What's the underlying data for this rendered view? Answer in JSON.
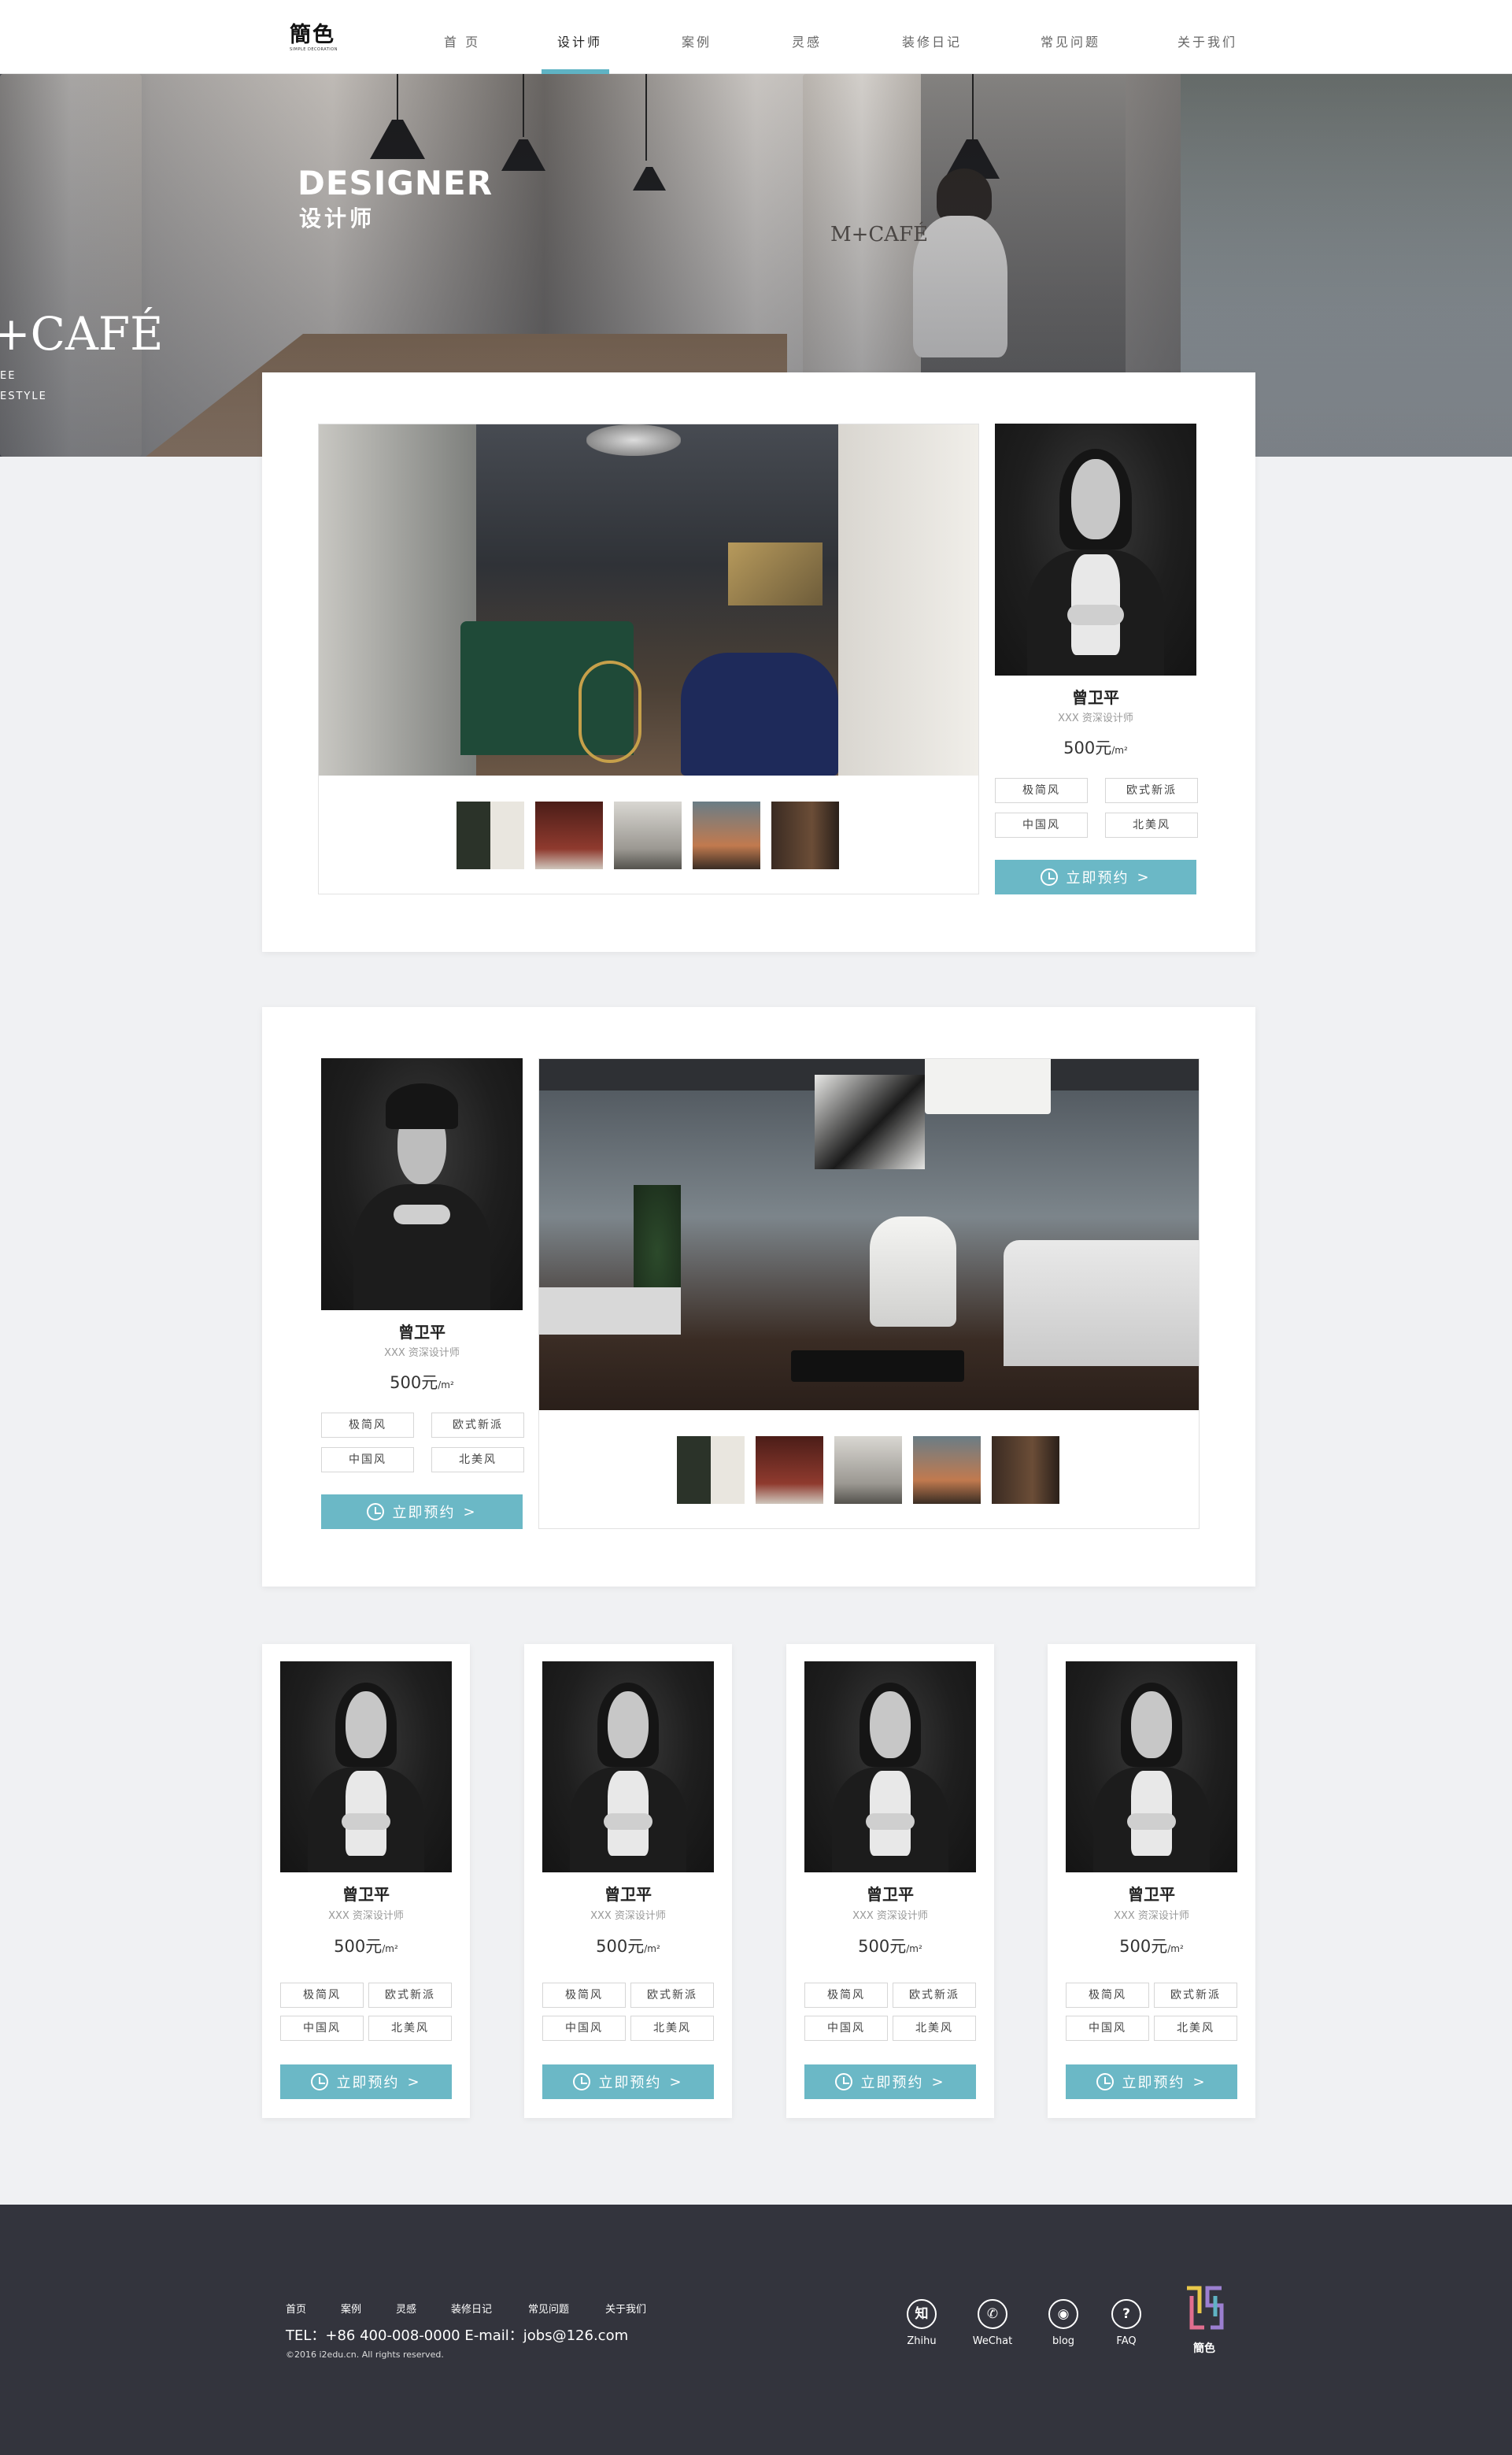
{
  "header": {
    "logo_text": "簡色",
    "logo_sub": "SIMPLE DECORATION",
    "nav": [
      {
        "label": "首 页"
      },
      {
        "label": "设计师"
      },
      {
        "label": "案例"
      },
      {
        "label": "灵感"
      },
      {
        "label": "装修日记"
      },
      {
        "label": "常见问题"
      },
      {
        "label": "关于我们"
      }
    ],
    "active_nav": "设计师"
  },
  "banner": {
    "title_en": "DESIGNER",
    "title_zh": "设计师",
    "sign_left": "+CAFÉ",
    "sign_left_small_1": "EE",
    "sign_left_small_2": "ESTYLE",
    "sign_mid": "M+CAFÉ"
  },
  "featured": [
    {
      "name": "曾卫平",
      "title": "XXX 资深设计师",
      "price": "500元",
      "unit": "/m²",
      "tags": [
        "极简风",
        "欧式新派",
        "中国风",
        "北美风"
      ],
      "book_label": "立即预约",
      "book_arrow": ">"
    },
    {
      "name": "曾卫平",
      "title": "XXX 资深设计师",
      "price": "500元",
      "unit": "/m²",
      "tags": [
        "极简风",
        "欧式新派",
        "中国风",
        "北美风"
      ],
      "book_label": "立即预约",
      "book_arrow": ">"
    }
  ],
  "designers": [
    {
      "name": "曾卫平",
      "title": "XXX 资深设计师",
      "price": "500元",
      "unit": "/m²",
      "tags": [
        "极简风",
        "欧式新派",
        "中国风",
        "北美风"
      ],
      "book_label": "立即预约",
      "book_arrow": ">"
    },
    {
      "name": "曾卫平",
      "title": "XXX 资深设计师",
      "price": "500元",
      "unit": "/m²",
      "tags": [
        "极简风",
        "欧式新派",
        "中国风",
        "北美风"
      ],
      "book_label": "立即预约",
      "book_arrow": ">"
    },
    {
      "name": "曾卫平",
      "title": "XXX 资深设计师",
      "price": "500元",
      "unit": "/m²",
      "tags": [
        "极简风",
        "欧式新派",
        "中国风",
        "北美风"
      ],
      "book_label": "立即预约",
      "book_arrow": ">"
    },
    {
      "name": "曾卫平",
      "title": "XXX 资深设计师",
      "price": "500元",
      "unit": "/m²",
      "tags": [
        "极简风",
        "欧式新派",
        "中国风",
        "北美风"
      ],
      "book_label": "立即预约",
      "book_arrow": ">"
    }
  ],
  "footer": {
    "nav": [
      {
        "label": "首页"
      },
      {
        "label": "案例"
      },
      {
        "label": "灵感"
      },
      {
        "label": "装修日记"
      },
      {
        "label": "常见问题"
      },
      {
        "label": "关于我们"
      }
    ],
    "contact": "TEL：+86 400-008-0000    E-mail：jobs@126.com",
    "copyright": "©2016 i2edu.cn. All rights reserved.",
    "social": [
      {
        "glyph": "知",
        "label": "Zhihu",
        "icon": "zhihu-icon"
      },
      {
        "glyph": "✆",
        "label": "WeChat",
        "icon": "wechat-icon"
      },
      {
        "glyph": "◉",
        "label": "blog",
        "icon": "weibo-icon"
      },
      {
        "glyph": "?",
        "label": "FAQ",
        "icon": "faq-icon"
      }
    ],
    "logo_text": "簡色"
  },
  "colors": {
    "accent": "#6bb8c6",
    "footer_bg": "#33343d",
    "page_bg": "#f0f1f3"
  }
}
